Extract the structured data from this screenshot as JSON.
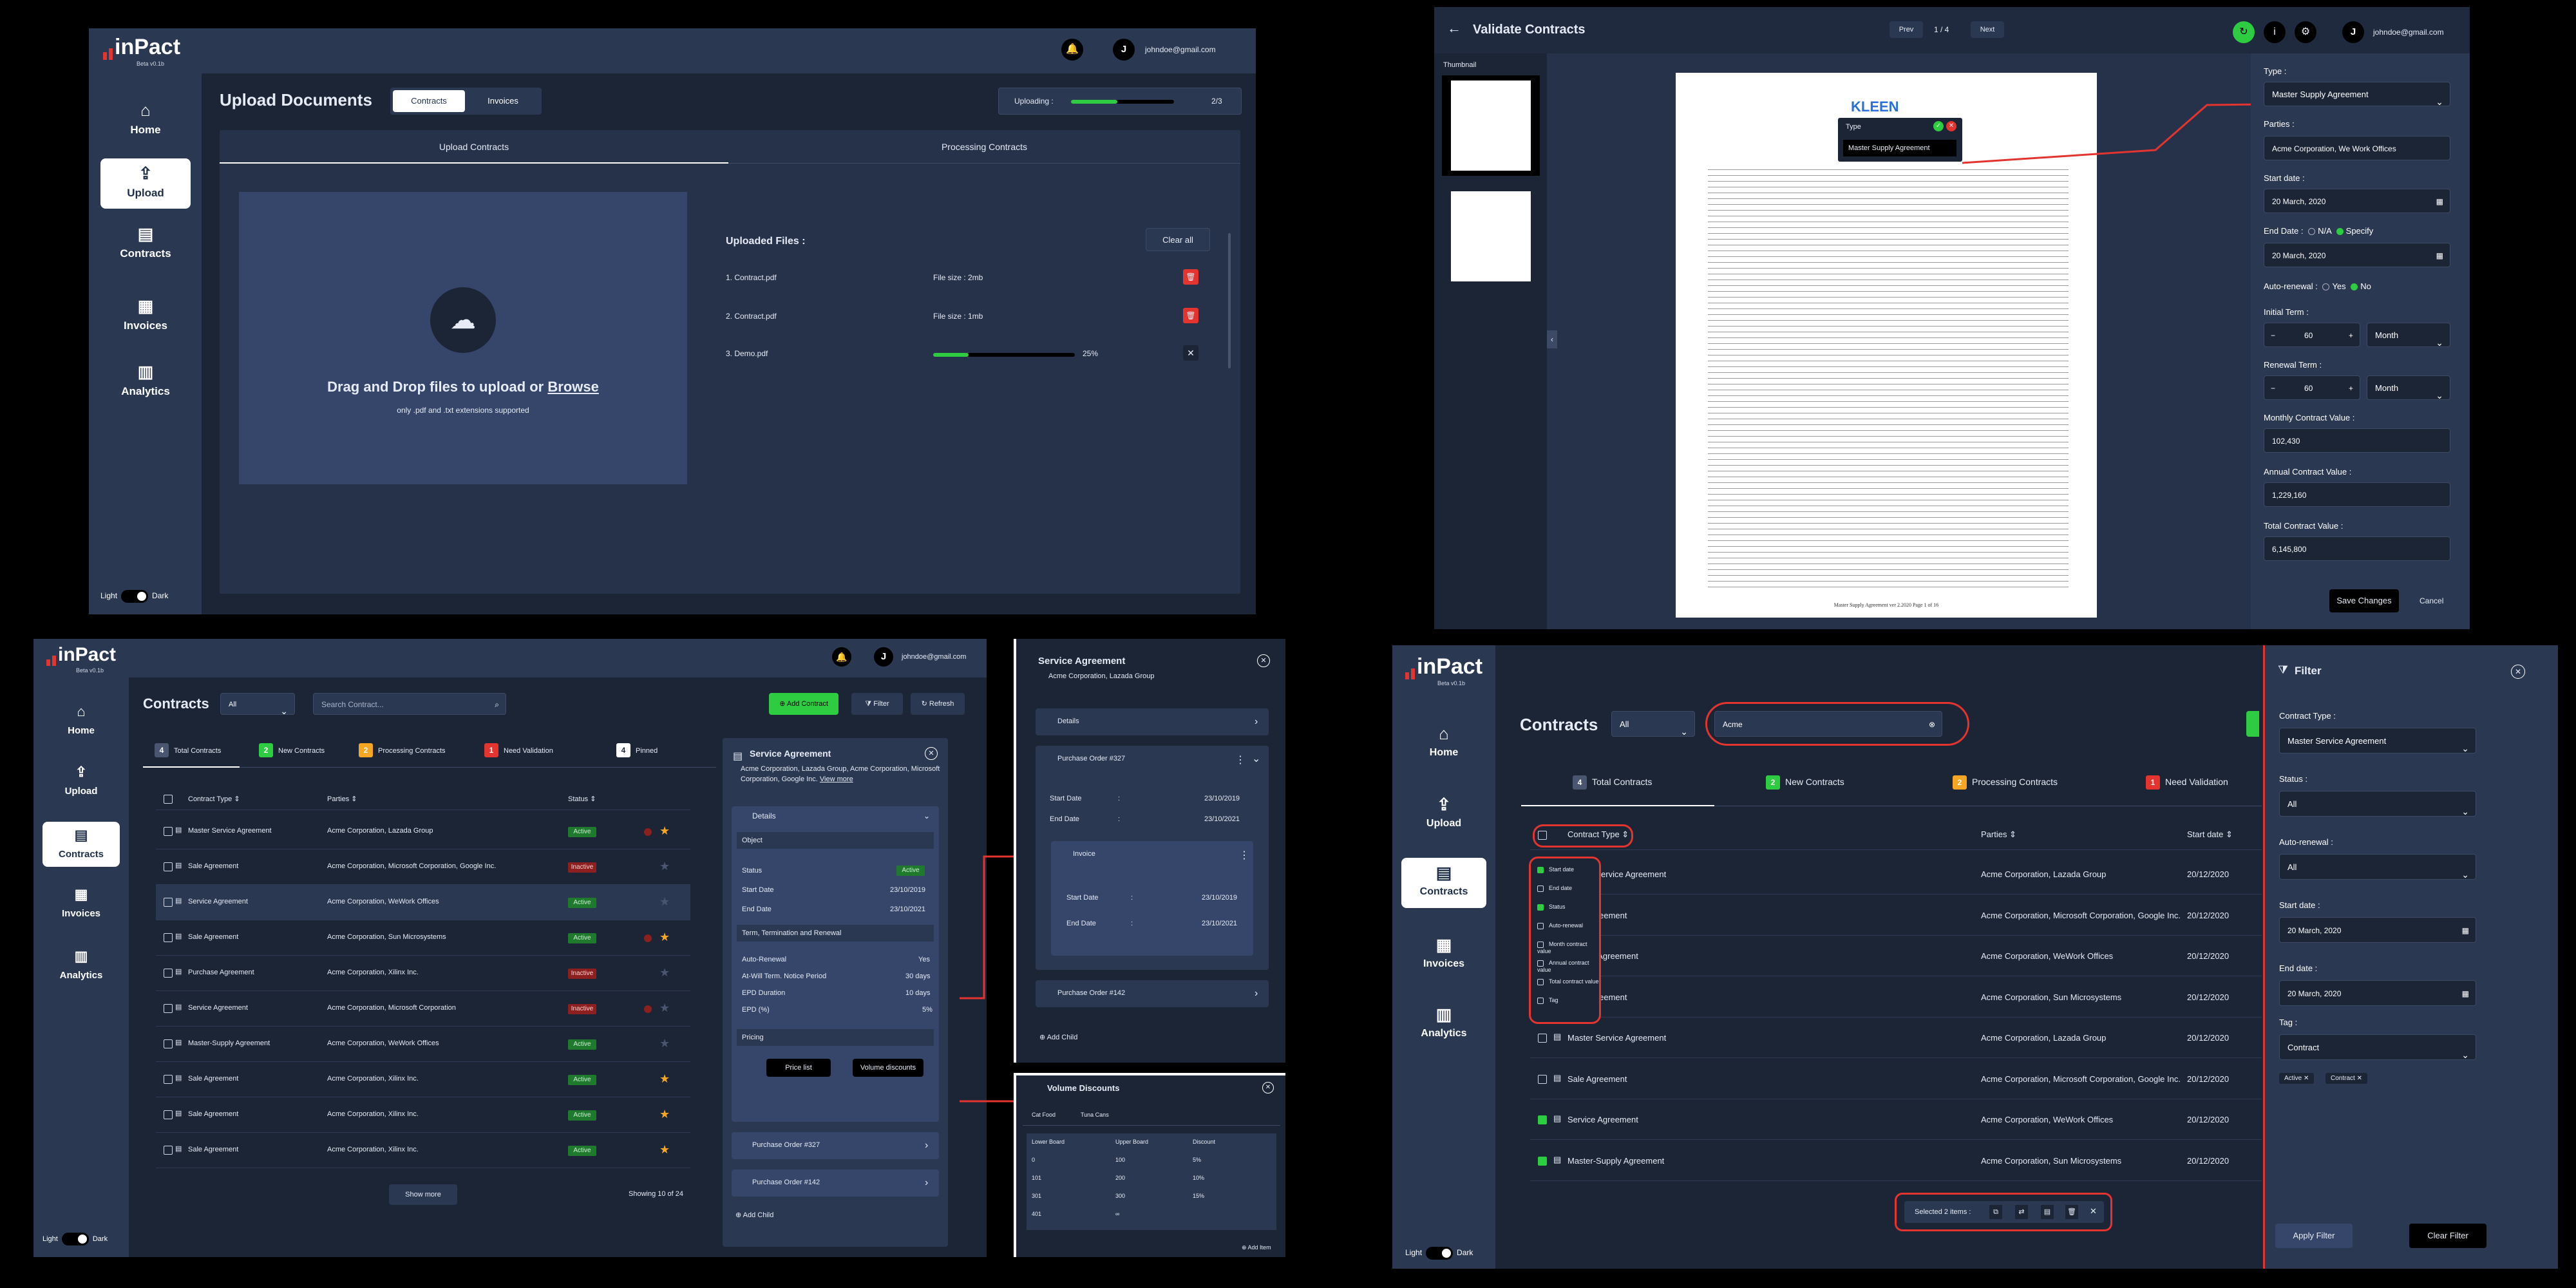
{
  "brand": {
    "name": "inPact",
    "version": "Beta v0.1b"
  },
  "user": {
    "email": "johndoe@gmail.com",
    "initial": "J"
  },
  "nav": {
    "home": "Home",
    "upload": "Upload",
    "contracts": "Contracts",
    "invoices": "Invoices",
    "analytics": "Analytics"
  },
  "theme": {
    "light": "Light",
    "dark": "Dark"
  },
  "upload": {
    "title": "Upload Documents",
    "toggle": [
      "Contracts",
      "Invoices"
    ],
    "uploading_label": "Uploading :",
    "uploading_count": "2/3",
    "uploading_progress": 0.45,
    "tabs": [
      "Upload Contracts",
      "Processing Contracts"
    ],
    "drop_title": "Drag and Drop files to upload or",
    "drop_link": "Browse",
    "drop_sub": "only .pdf and .txt extensions supported",
    "list_title": "Uploaded Files :",
    "clear_all": "Clear all",
    "files": [
      {
        "name": "1. Contract.pdf",
        "size": "File size : 2mb"
      },
      {
        "name": "2. Contract.pdf",
        "size": "File size : 1mb"
      },
      {
        "name": "3. Demo.pdf",
        "percent": "25%",
        "progress": 0.25
      }
    ]
  },
  "validate": {
    "title": "Validate Contracts",
    "prev": "Prev",
    "page": "1 / 4",
    "next": "Next",
    "thumbnail": "Thumbnail",
    "popup_label": "Type",
    "popup_value": "Master Supply Agreement",
    "fields": {
      "type_label": "Type :",
      "type_value": "Master Supply Agreement",
      "parties_label": "Parties :",
      "parties_value": "Acme Corporation, We Work Offices",
      "start_label": "Start date :",
      "start_value": "20 March, 2020",
      "end_label": "End Date :",
      "end_na": "N/A",
      "end_specify": "Specify",
      "end_value": "20 March, 2020",
      "auto_label": "Auto-renewal :",
      "auto_yes": "Yes",
      "auto_no": "No",
      "initial_label": "Initial Term :",
      "initial_value": "60",
      "initial_unit": "Month",
      "renewal_label": "Renewal Term :",
      "renewal_value": "60",
      "renewal_unit": "Month",
      "monthly_label": "Monthly Contract Value :",
      "monthly_value": "102,430",
      "annual_label": "Annual Contract Value :",
      "annual_value": "1,229,160",
      "total_label": "Total Contract Value :",
      "total_value": "6,145,800"
    },
    "save": "Save Changes",
    "cancel": "Cancel",
    "doc_footer": "Master Supply Agreement ver 2.2020 Page 1 of 16"
  },
  "contracts": {
    "title": "Contracts",
    "filter_all": "All",
    "search_placeholder": "Search Contract...",
    "add": "Add Contract",
    "filter": "Filter",
    "refresh": "Refresh",
    "stats": [
      {
        "count": "4",
        "label": "Total Contracts",
        "color": "#4a5670"
      },
      {
        "count": "2",
        "label": "New Contracts",
        "color": "#2ecc40"
      },
      {
        "count": "2",
        "label": "Processing Contracts",
        "color": "#f5a623"
      },
      {
        "count": "1",
        "label": "Need Validation",
        "color": "#e3342f"
      },
      {
        "count": "4",
        "label": "Pinned",
        "color": "#ffffff"
      }
    ],
    "cols": [
      "Contract Type",
      "Parties",
      "Status"
    ],
    "rows": [
      {
        "type": "Master Service Agreement",
        "parties": "Acme Corporation, Lazada Group",
        "status": "Active",
        "starred": true,
        "pin": true
      },
      {
        "type": "Sale Agreement",
        "parties": "Acme Corporation, Microsoft Corporation, Google Inc.",
        "status": "Inactive",
        "starred": false,
        "pin": false
      },
      {
        "type": "Service Agreement",
        "parties": "Acme Corporation, WeWork Offices",
        "status": "Active",
        "starred": false,
        "pin": false
      },
      {
        "type": "Sale Agreement",
        "parties": "Acme Corporation, Sun Microsystems",
        "status": "Active",
        "starred": true,
        "pin": true
      },
      {
        "type": "Purchase Agreement",
        "parties": "Acme Corporation, Xilinx Inc.",
        "status": "Inactive",
        "starred": false,
        "pin": false
      },
      {
        "type": "Service Agreement",
        "parties": "Acme Corporation, Microsoft Corporation",
        "status": "Inactive",
        "starred": false,
        "pin": true
      },
      {
        "type": "Master-Supply Agreement",
        "parties": "Acme Corporation, WeWork Offices",
        "status": "Active",
        "starred": false,
        "pin": false
      },
      {
        "type": "Sale Agreement",
        "parties": "Acme Corporation, Xilinx Inc.",
        "status": "Active",
        "starred": true,
        "pin": false
      },
      {
        "type": "Sale Agreement",
        "parties": "Acme Corporation, Xilinx Inc.",
        "status": "Active",
        "starred": true,
        "pin": false
      },
      {
        "type": "Sale Agreement",
        "parties": "Acme Corporation, Xilinx Inc.",
        "status": "Active",
        "starred": true,
        "pin": false
      }
    ],
    "show_more": "Show more",
    "showing": "Showing 10 of 24",
    "detail": {
      "title": "Service Agreement",
      "parties": "Acme Corporation, Lazada Group, Acme Corporation, Microsoft Corporation, Google Inc.",
      "view_more": "View more",
      "details": "Details",
      "object": "Object",
      "status_label": "Status",
      "status_value": "Active",
      "start_label": "Start Date",
      "start_value": "23/10/2019",
      "end_label": "End Date",
      "end_value": "23/10/2021",
      "term_head": "Term, Termination and Renewal",
      "auto_label": "Auto-Renewal",
      "auto_value": "Yes",
      "atwill_label": "At-Will Term. Notice Period",
      "atwill_value": "30 days",
      "epd_label": "EPD Duration",
      "epd_value": "10 days",
      "epdp_label": "EPD (%)",
      "epdp_value": "5%",
      "pricing": "Pricing",
      "price_list": "Price list",
      "volume": "Volume discounts",
      "po1": "Purchase Order #327",
      "po2": "Purchase Order #142",
      "add_child": "Add Child"
    },
    "detail2": {
      "title": "Service Agreement",
      "parties": "Acme Corporation, Lazada Group",
      "details": "Details",
      "po": "Purchase Order #327",
      "start_label": "Start Date",
      "start_value": "23/10/2019",
      "end_label": "End Date",
      "end_value": "23/10/2021",
      "invoice": "Invoice",
      "po2": "Purchase Order #142",
      "add_child": "Add Child"
    },
    "volume_panel": {
      "title": "Volume Discounts",
      "tabs": [
        "Cat Food",
        "Tuna Cans"
      ],
      "head": [
        "Lower Board",
        "Upper Board",
        "Discount"
      ],
      "rows": [
        [
          "0",
          "100",
          "5%"
        ],
        [
          "101",
          "200",
          "10%"
        ],
        [
          "301",
          "300",
          "15%"
        ],
        [
          "401",
          "∞",
          ""
        ]
      ],
      "add": "Add Item"
    }
  },
  "filterview": {
    "title": "Contracts",
    "filter_all": "All",
    "search_value": "Acme",
    "stats": [
      {
        "count": "4",
        "label": "Total Contracts",
        "color": "#4a5670"
      },
      {
        "count": "2",
        "label": "New Contracts",
        "color": "#2ecc40"
      },
      {
        "count": "2",
        "label": "Processing Contracts",
        "color": "#f5a623"
      },
      {
        "count": "1",
        "label": "Need Validation",
        "color": "#e3342f"
      }
    ],
    "cols": [
      "Contract Type",
      "Parties",
      "Start date"
    ],
    "col_menu": [
      "Start date",
      "End date",
      "Status",
      "Auto-renewal",
      "Month contract value",
      "Annual contract value",
      "Total contract value",
      "Tag"
    ],
    "rows": [
      {
        "type": "Master Service Agreement",
        "parties": "Acme Corporation, Lazada Group",
        "date": "20/12/2020",
        "checked": false
      },
      {
        "type": "Sale Agreement",
        "parties": "Acme Corporation, Microsoft Corporation, Google Inc.",
        "date": "20/12/2020",
        "checked": false
      },
      {
        "type": "Service Agreement",
        "parties": "Acme Corporation, WeWork Offices",
        "date": "20/12/2020",
        "checked": false
      },
      {
        "type": "Sale Agreement",
        "parties": "Acme Corporation, Sun Microsystems",
        "date": "20/12/2020",
        "checked": false
      },
      {
        "type": "Master Service Agreement",
        "parties": "Acme Corporation, Lazada Group",
        "date": "20/12/2020",
        "checked": false
      },
      {
        "type": "Sale Agreement",
        "parties": "Acme Corporation, Microsoft Corporation, Google Inc.",
        "date": "20/12/2020",
        "checked": false
      },
      {
        "type": "Service Agreement",
        "parties": "Acme Corporation, WeWork Offices",
        "date": "20/12/2020",
        "checked": true
      },
      {
        "type": "Master-Supply Agreement",
        "parties": "Acme Corporation, Sun Microsystems",
        "date": "20/12/2020",
        "checked": true
      }
    ],
    "selected": "Selected 2 items :",
    "filter": {
      "title": "Filter",
      "type_label": "Contract Type :",
      "type_value": "Master Service Agreement",
      "status_label": "Status :",
      "status_value": "All",
      "auto_label": "Auto-renewal :",
      "auto_value": "All",
      "start_label": "Start date :",
      "start_value": "20 March, 2020",
      "end_label": "End date :",
      "end_value": "20 March, 2020",
      "tag_label": "Tag :",
      "tag_value": "Contract",
      "chips": [
        "Active",
        "Contract"
      ],
      "apply": "Apply Filter",
      "clear": "Clear Filter"
    }
  }
}
